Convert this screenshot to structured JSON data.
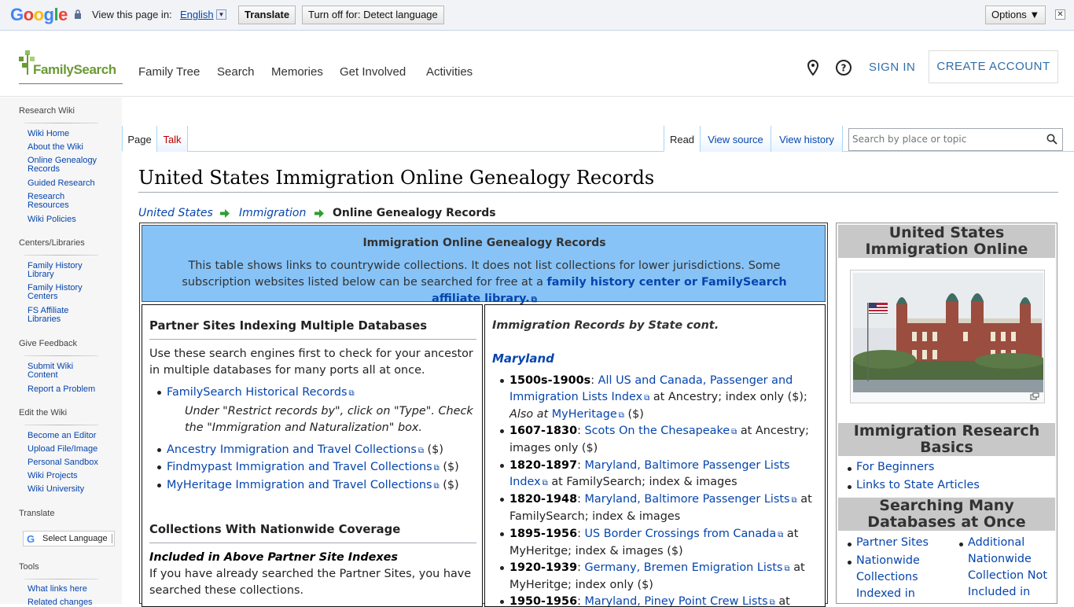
{
  "translate_bar": {
    "logo": "Google",
    "view_label": "View this page in:",
    "language": "English",
    "translate_button": "Translate",
    "turn_off_button": "Turn off for: Detect language",
    "options_button": "Options ▼",
    "close": "✕"
  },
  "header": {
    "logo_text": "FamilySearch",
    "nav": [
      "Family Tree",
      "Search",
      "Memories",
      "Get Involved",
      "Activities"
    ],
    "sign_in": "SIGN IN",
    "create_account": "CREATE ACCOUNT"
  },
  "sidebar": {
    "sections": [
      {
        "title": "Research Wiki",
        "items": [
          "Wiki Home",
          "About the Wiki",
          "Online Genealogy Records",
          "Guided Research",
          "Research Resources",
          "Wiki Policies"
        ]
      },
      {
        "title": "Centers/Libraries",
        "items": [
          "Family History Library",
          "Family History Centers",
          "FS Affiliate Libraries"
        ]
      },
      {
        "title": "Give Feedback",
        "items": [
          "Submit Wiki Content",
          "Report a Problem"
        ]
      },
      {
        "title": "Edit the Wiki",
        "items": [
          "Become an Editor",
          "Upload File/Image",
          "Personal Sandbox",
          "Wiki Projects",
          "Wiki University"
        ]
      },
      {
        "title": "Translate",
        "items": []
      },
      {
        "title": "Tools",
        "items": [
          "What links here",
          "Related changes"
        ]
      }
    ],
    "select_language": "Select Language"
  },
  "tabs": {
    "page": "Page",
    "talk": "Talk",
    "read": "Read",
    "view_source": "View source",
    "view_history": "View history"
  },
  "search": {
    "placeholder": "Search by place or topic"
  },
  "page": {
    "title": "United States Immigration Online Genealogy Records",
    "breadcrumb": [
      "United States",
      "Immigration",
      "Online Genealogy Records"
    ]
  },
  "table": {
    "heading": "Immigration Online Genealogy Records",
    "intro": "This table shows links to countrywide collections. It does not list collections for lower jurisdictions. Some subscription websites listed below can be searched for free at a ",
    "intro_link": "family history center or FamilySearch affiliate library.",
    "left": {
      "partner_heading": "Partner Sites Indexing Multiple Databases",
      "partner_text": "Use these search engines first to check for your ancestor in multiple databases for many ports all at once.",
      "fs_link": "FamilySearch Historical Records",
      "fs_note": "Under \"Restrict records by\", click on \"Type\". Check the \"Immigration and Naturalization\" box.",
      "partner_links": [
        {
          "link": "Ancestry Immigration and Travel Collections",
          "suffix": " ($)"
        },
        {
          "link": "Findmypast Immigration and Travel Collections",
          "suffix": " ($)"
        },
        {
          "link": "MyHeritage Immigration and Travel Collections",
          "suffix": " ($)"
        }
      ],
      "nationwide_heading": "Collections With Nationwide Coverage",
      "included_heading": "Included in Above Partner Site Indexes",
      "included_text": "If you have already searched the Partner Sites, you have searched these collections."
    },
    "right": {
      "heading": "Immigration Records by State cont.",
      "state": "Maryland",
      "records": [
        {
          "years": "1500s-1900s",
          "link": "All US and Canada, Passenger and Immigration Lists Index",
          "after": " at Ancestry; index only ($); ",
          "also": "Also at ",
          "link2": "MyHeritage",
          "after2": " ($)"
        },
        {
          "years": "1607-1830",
          "link": "Scots On the Chesapeake",
          "after": " at Ancestry; images only ($)"
        },
        {
          "years": "1820-1897",
          "link": "Maryland, Baltimore Passenger Lists Index",
          "after": " at FamilySearch; index & images"
        },
        {
          "years": "1820-1948",
          "link": "Maryland, Baltimore Passenger Lists",
          "after": " at FamilySearch; index & images"
        },
        {
          "years": "1895-1956",
          "link": "US Border Crossings from Canada",
          "after": " at MyHeritge; index & images ($)"
        },
        {
          "years": "1920-1939",
          "link": "Germany, Bremen Emigration Lists",
          "after": " at MyHeritge; index only ($)"
        },
        {
          "years": "1950-1956",
          "link": "Maryland, Piney Point Crew Lists",
          "after": " at"
        }
      ]
    }
  },
  "infobox": {
    "title": "United States Immigration Online",
    "basics_heading": "Immigration Research Basics",
    "basics_links": [
      "For Beginners",
      "Links to State Articles"
    ],
    "searching_heading": "Searching Many Databases at Once",
    "searching_left": [
      "Partner Sites",
      "Nationwide Collections Indexed in"
    ],
    "searching_right": [
      "Additional Nationwide Collection Not Included in"
    ]
  },
  "colors": {
    "brand_green": "#6b9a34",
    "link": "#0645ad",
    "table_blue": "#87c3f7",
    "fs_blue": "#2f6faa"
  }
}
